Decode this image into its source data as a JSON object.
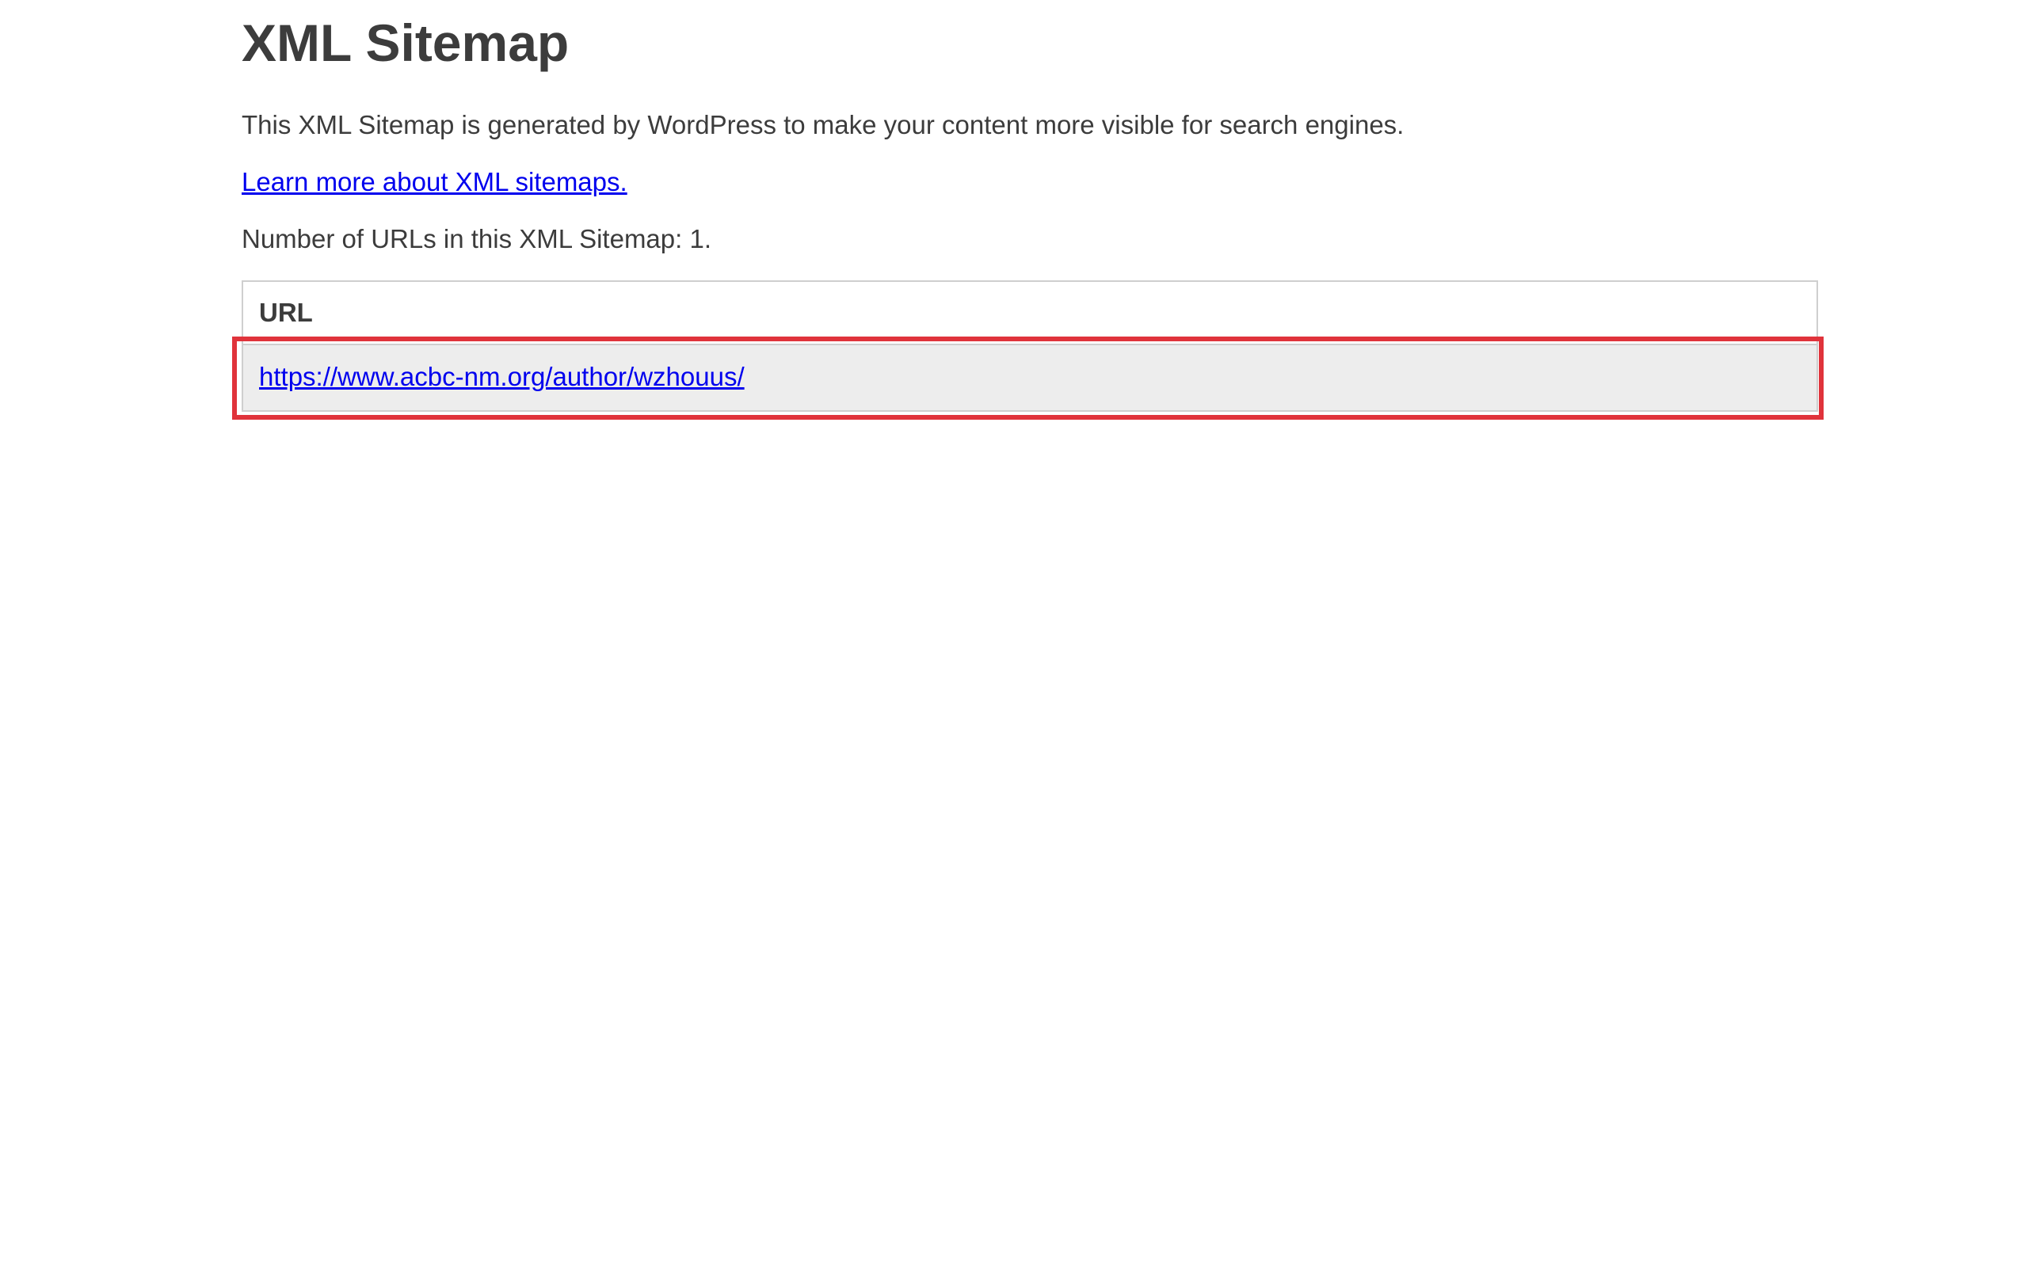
{
  "header": {
    "title": "XML Sitemap"
  },
  "intro": {
    "description": "This XML Sitemap is generated by WordPress to make your content more visible for search engines.",
    "learn_more_link": "Learn more about XML sitemaps.",
    "url_count_text": "Number of URLs in this XML Sitemap: 1."
  },
  "table": {
    "column_header": "URL",
    "rows": [
      {
        "url": "https://www.acbc-nm.org/author/wzhouus/"
      }
    ]
  },
  "colors": {
    "text": "#3c3c3c",
    "link": "#0000ee",
    "row_background": "#ededed",
    "border": "#cfcfcf",
    "highlight": "#e0333b"
  }
}
